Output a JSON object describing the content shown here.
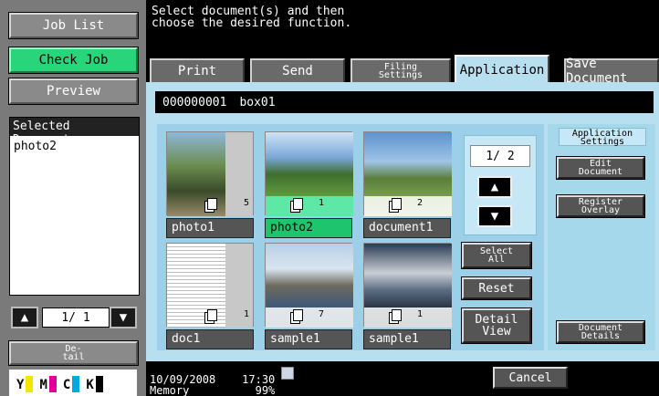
{
  "left": {
    "job_list": "Job List",
    "check_job": "Check Job",
    "preview": "Preview",
    "selected_header": "Selected Documents",
    "selected_items": [
      "photo2"
    ],
    "page": "1/  1",
    "detail": "De-\ntail",
    "toner": [
      {
        "label": "Y",
        "color": "#f2e600"
      },
      {
        "label": "M",
        "color": "#e0009a"
      },
      {
        "label": "C",
        "color": "#00a9e0"
      },
      {
        "label": "K",
        "color": "#000000"
      }
    ]
  },
  "message": "Select document(s) and then\nchoose the desired function.",
  "tabs": {
    "print": "Print",
    "send": "Send",
    "filing": "Filing\nSettings",
    "application": "Application",
    "save": "Save Document"
  },
  "box": {
    "number": "000000001",
    "name": "box01"
  },
  "documents": [
    {
      "label": "photo1",
      "count": "5"
    },
    {
      "label": "photo2",
      "count": "1"
    },
    {
      "label": "document1",
      "count": "2"
    },
    {
      "label": "doc1",
      "count": "1"
    },
    {
      "label": "sample1",
      "count": "7"
    },
    {
      "label": "sample1",
      "count": "1"
    }
  ],
  "pager": {
    "page": "1/  2"
  },
  "buttons": {
    "select_all": "Select\nAll",
    "reset": "Reset",
    "detail_view": "Detail\nView"
  },
  "application_settings": {
    "title": "Application\nSettings",
    "edit": "Edit\nDocument",
    "register": "Register\nOverlay",
    "details": "Document\nDetails"
  },
  "footer": {
    "datetime": "10/09/2008    17:30\nMemory          99%",
    "cancel": "Cancel"
  },
  "colors": {
    "accent": "#1fc46f",
    "panel": "#b8dff0"
  }
}
